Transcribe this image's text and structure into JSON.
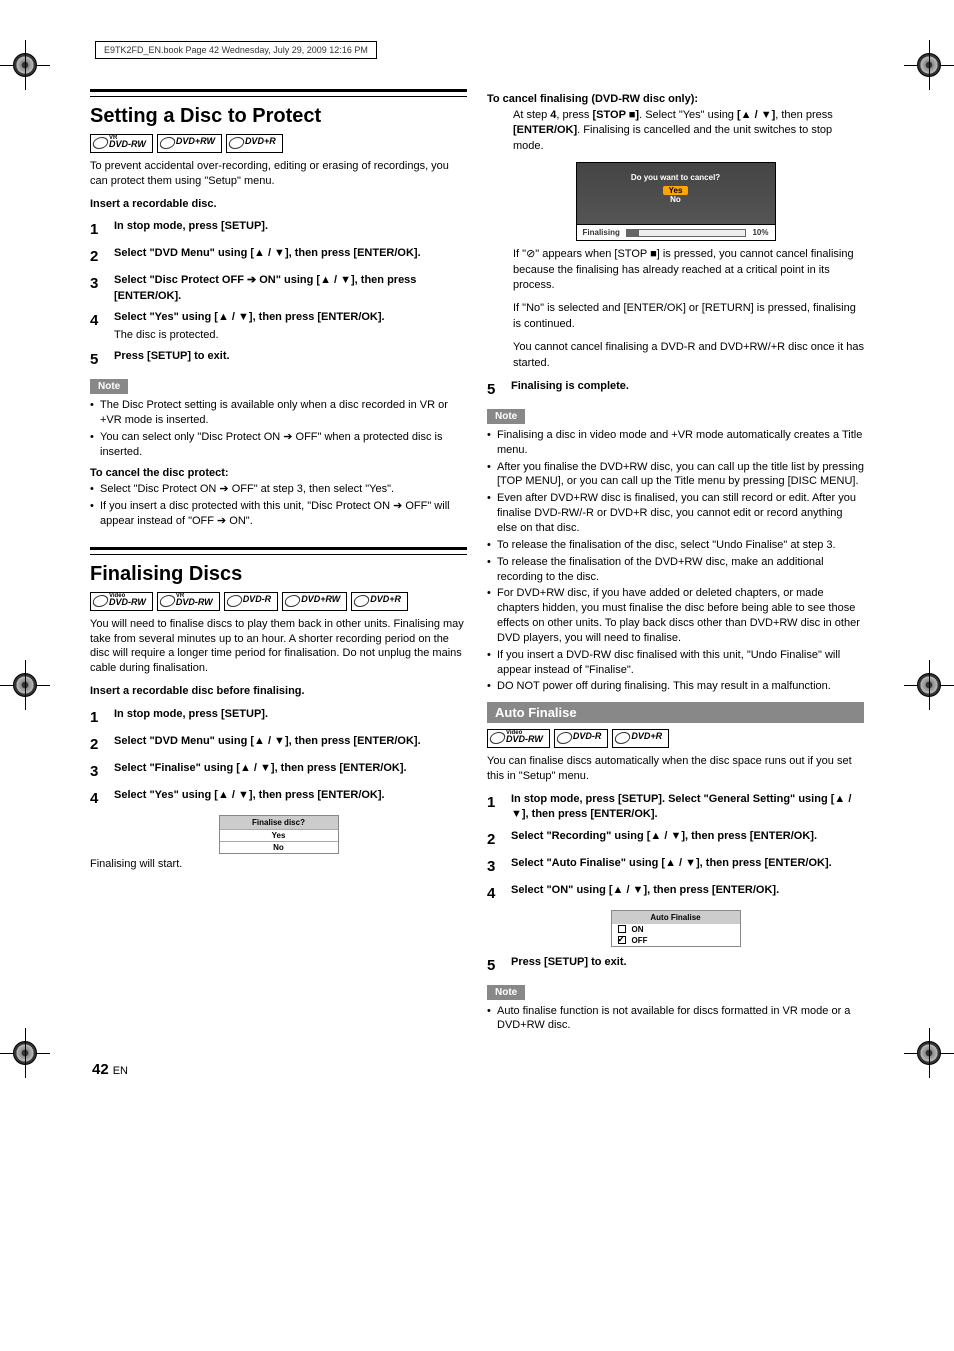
{
  "print_header": "E9TK2FD_EN.book  Page 42  Wednesday, July 29, 2009  12:16 PM",
  "page_number": "42",
  "page_lang": "EN",
  "left": {
    "section1": {
      "title": "Setting a Disc to Protect",
      "badges": [
        "DVD-RW",
        "DVD+RW",
        "DVD+R"
      ],
      "badge_tops": [
        "VR",
        "",
        ""
      ],
      "intro": "To prevent accidental over-recording, editing or erasing of recordings, you can protect them using \"Setup\" menu.",
      "lead": "Insert a recordable disc.",
      "steps": [
        {
          "n": "1",
          "main": "In stop mode, press [SETUP]."
        },
        {
          "n": "2",
          "main": "Select \"DVD Menu\" using [▲ / ▼], then press [ENTER/OK]."
        },
        {
          "n": "3",
          "main": "Select \"Disc Protect OFF ➔ ON\" using [▲ / ▼], then press [ENTER/OK]."
        },
        {
          "n": "4",
          "main": "Select \"Yes\" using [▲ / ▼], then press [ENTER/OK].",
          "sub": "The disc is protected."
        },
        {
          "n": "5",
          "main": "Press [SETUP] to exit."
        }
      ],
      "note_label": "Note",
      "notes": [
        "The Disc Protect setting is available only when a disc recorded in VR or +VR mode is inserted.",
        "You can select only \"Disc Protect ON ➔ OFF\" when a protected disc is inserted."
      ],
      "cancel_head": "To cancel the disc protect:",
      "cancel_items": [
        "Select \"Disc Protect ON ➔ OFF\" at step 3, then select \"Yes\".",
        "If you insert a disc protected with this unit, \"Disc Protect ON ➔ OFF\" will appear instead of \"OFF ➔ ON\"."
      ]
    },
    "section2": {
      "title": "Finalising Discs",
      "badges": [
        "DVD-RW",
        "DVD-RW",
        "DVD-R",
        "DVD+RW",
        "DVD+R"
      ],
      "badge_tops": [
        "Video",
        "VR",
        "",
        "",
        ""
      ],
      "intro": "You will need to finalise discs to play them back in other units. Finalising may take from several minutes up to an hour. A shorter recording period on the disc will require a longer time period for finalisation. Do not unplug the mains cable during finalisation.",
      "lead": "Insert a recordable disc before finalising.",
      "steps": [
        {
          "n": "1",
          "main": "In stop mode, press [SETUP]."
        },
        {
          "n": "2",
          "main": "Select \"DVD Menu\" using [▲ / ▼], then press [ENTER/OK]."
        },
        {
          "n": "3",
          "main": "Select \"Finalise\" using [▲ / ▼], then press [ENTER/OK]."
        },
        {
          "n": "4",
          "main": "Select \"Yes\" using [▲ / ▼], then press [ENTER/OK]."
        }
      ],
      "dialog": {
        "title": "Finalise disc?",
        "opt1": "Yes",
        "opt2": "No"
      },
      "caption": "Finalising will start."
    }
  },
  "right": {
    "cancel_head": "To cancel finalising (DVD-RW disc only):",
    "cancel_body_parts": [
      "At step ",
      "4",
      ", press ",
      "[STOP ■]",
      ". Select \"Yes\" using ",
      "[▲ / ▼]",
      ", then press ",
      "[ENTER/OK]",
      ". Finalising is cancelled and the unit switches to stop mode."
    ],
    "screen": {
      "q": "Do you want to cancel?",
      "yes": "Yes",
      "no": "No",
      "label": "Finalising",
      "pct": "10%"
    },
    "paras": [
      "If \"⊘\" appears when [STOP ■] is pressed, you cannot cancel finalising because the finalising has already reached at a critical point in its process.",
      "If \"No\" is selected and [ENTER/OK] or [RETURN] is pressed, finalising is continued.",
      "You cannot cancel finalising a DVD-R and DVD+RW/+R disc once it has started."
    ],
    "step5": {
      "n": "5",
      "main": "Finalising is complete."
    },
    "note_label": "Note",
    "notes": [
      "Finalising a disc in video mode and +VR mode automatically creates a Title menu.",
      "After you finalise the DVD+RW disc, you can call up the title list by pressing [TOP MENU], or you can call up the Title menu by pressing [DISC MENU].",
      "Even after DVD+RW disc is finalised, you can still record or edit. After you finalise DVD-RW/-R or DVD+R disc, you cannot edit or record anything else on that disc.",
      "To release the finalisation of the disc, select \"Undo Finalise\" at step 3.",
      "To release the finalisation of the DVD+RW disc, make an additional recording to the disc.",
      "For DVD+RW disc, if you have added or deleted chapters, or made chapters hidden, you must finalise the disc before being able to see those effects on other units. To play back discs other than DVD+RW disc in other DVD players, you will need to finalise.",
      "If you insert a DVD-RW disc finalised with this unit, \"Undo Finalise\" will appear instead of \"Finalise\".",
      "DO NOT power off during finalising. This may result in a malfunction."
    ],
    "auto": {
      "bar": "Auto Finalise",
      "badges": [
        "DVD-RW",
        "DVD-R",
        "DVD+R"
      ],
      "badge_tops": [
        "Video",
        "",
        ""
      ],
      "intro": "You can finalise discs automatically when the disc space runs out if you set this in \"Setup\" menu.",
      "steps": [
        {
          "n": "1",
          "main": "In stop mode, press [SETUP]. Select \"General Setting\" using [▲ / ▼], then press [ENTER/OK]."
        },
        {
          "n": "2",
          "main": "Select \"Recording\" using [▲ / ▼], then press [ENTER/OK]."
        },
        {
          "n": "3",
          "main": "Select \"Auto Finalise\" using [▲ / ▼], then press [ENTER/OK]."
        },
        {
          "n": "4",
          "main": "Select \"ON\" using [▲ / ▼], then press [ENTER/OK]."
        }
      ],
      "box": {
        "title": "Auto Finalise",
        "on": "ON",
        "off": "OFF"
      },
      "step5": {
        "n": "5",
        "main": "Press [SETUP] to exit."
      },
      "note_label": "Note",
      "notes": [
        "Auto finalise function is not available for discs formatted in VR mode or a DVD+RW disc."
      ]
    }
  }
}
